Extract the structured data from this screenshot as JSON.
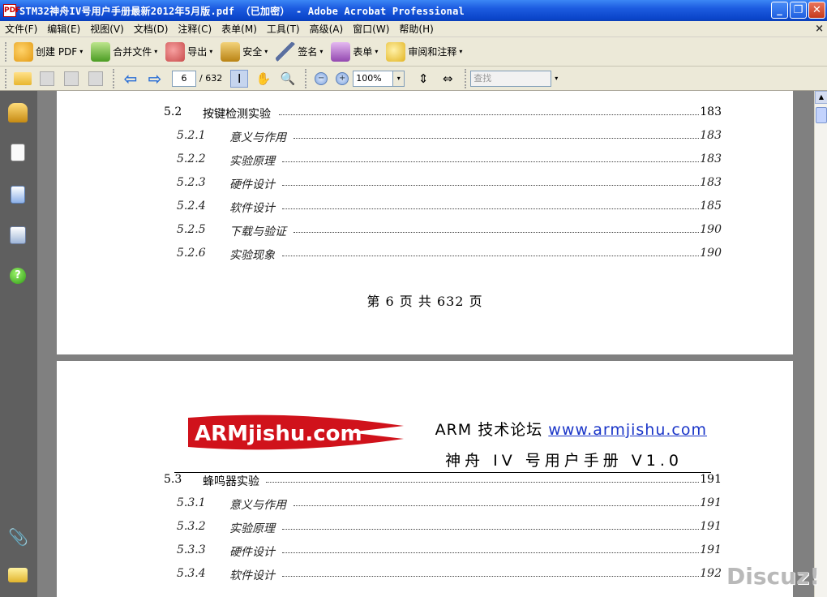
{
  "window": {
    "title": "STM32神舟IV号用户手册最新2012年5月版.pdf （已加密） - Adobe Acrobat Professional",
    "app_icon_label": "PDF",
    "minimize": "_",
    "maximize": "❐",
    "close": "✕"
  },
  "menu": {
    "items": [
      "文件(F)",
      "编辑(E)",
      "视图(V)",
      "文档(D)",
      "注释(C)",
      "表单(M)",
      "工具(T)",
      "高级(A)",
      "窗口(W)",
      "帮助(H)"
    ],
    "close_doc": "×"
  },
  "toolbar1": {
    "create_pdf": "创建 PDF",
    "merge_files": "合并文件",
    "export": "导出",
    "secure": "安全",
    "sign": "签名",
    "forms": "表单",
    "review_comment": "审阅和注释",
    "arrow": "▾"
  },
  "toolbar2": {
    "page_current": "6",
    "page_total": "/ 632",
    "zoom_value": "100%",
    "search_placeholder": "查找",
    "dropdown": "▾",
    "prev_arrow": "⇦",
    "next_arrow": "⇨",
    "select_tool": "I",
    "hand_tool": "✋",
    "zoom_tool": "🔍",
    "zoom_out": "−",
    "zoom_in": "+",
    "fit_page": "⇕",
    "fit_width": "⇔"
  },
  "page1": {
    "toc": [
      {
        "num": "5.2",
        "title": "按键检测实验",
        "page": "183",
        "level": 2
      },
      {
        "num": "5.2.1",
        "title": "意义与作用",
        "page": "183",
        "level": 3
      },
      {
        "num": "5.2.2",
        "title": "实验原理",
        "page": "183",
        "level": 3
      },
      {
        "num": "5.2.3",
        "title": "硬件设计",
        "page": "183",
        "level": 3
      },
      {
        "num": "5.2.4",
        "title": "软件设计",
        "page": "185",
        "level": 3
      },
      {
        "num": "5.2.5",
        "title": "下载与验证",
        "page": "190",
        "level": 3
      },
      {
        "num": "5.2.6",
        "title": "实验现象",
        "page": "190",
        "level": 3
      }
    ],
    "footer": "第 6 页  共 632 页"
  },
  "page2": {
    "logo_text": "ARMjishu.com",
    "forum_label": "ARM 技术论坛",
    "forum_url": "www.armjishu.com",
    "manual_title": "神舟 IV 号用户手册 V1.0",
    "toc": [
      {
        "num": "5.3",
        "title": "蜂鸣器实验",
        "page": "191",
        "level": 2
      },
      {
        "num": "5.3.1",
        "title": "意义与作用",
        "page": "191",
        "level": 3
      },
      {
        "num": "5.3.2",
        "title": "实验原理",
        "page": "191",
        "level": 3
      },
      {
        "num": "5.3.3",
        "title": "硬件设计",
        "page": "191",
        "level": 3
      },
      {
        "num": "5.3.4",
        "title": "软件设计",
        "page": "192",
        "level": 3
      }
    ]
  },
  "left_panel": {
    "help_icon": "?",
    "attach_icon": "📎"
  },
  "scrollbar": {
    "up": "▲"
  },
  "watermark": "Discuz!"
}
